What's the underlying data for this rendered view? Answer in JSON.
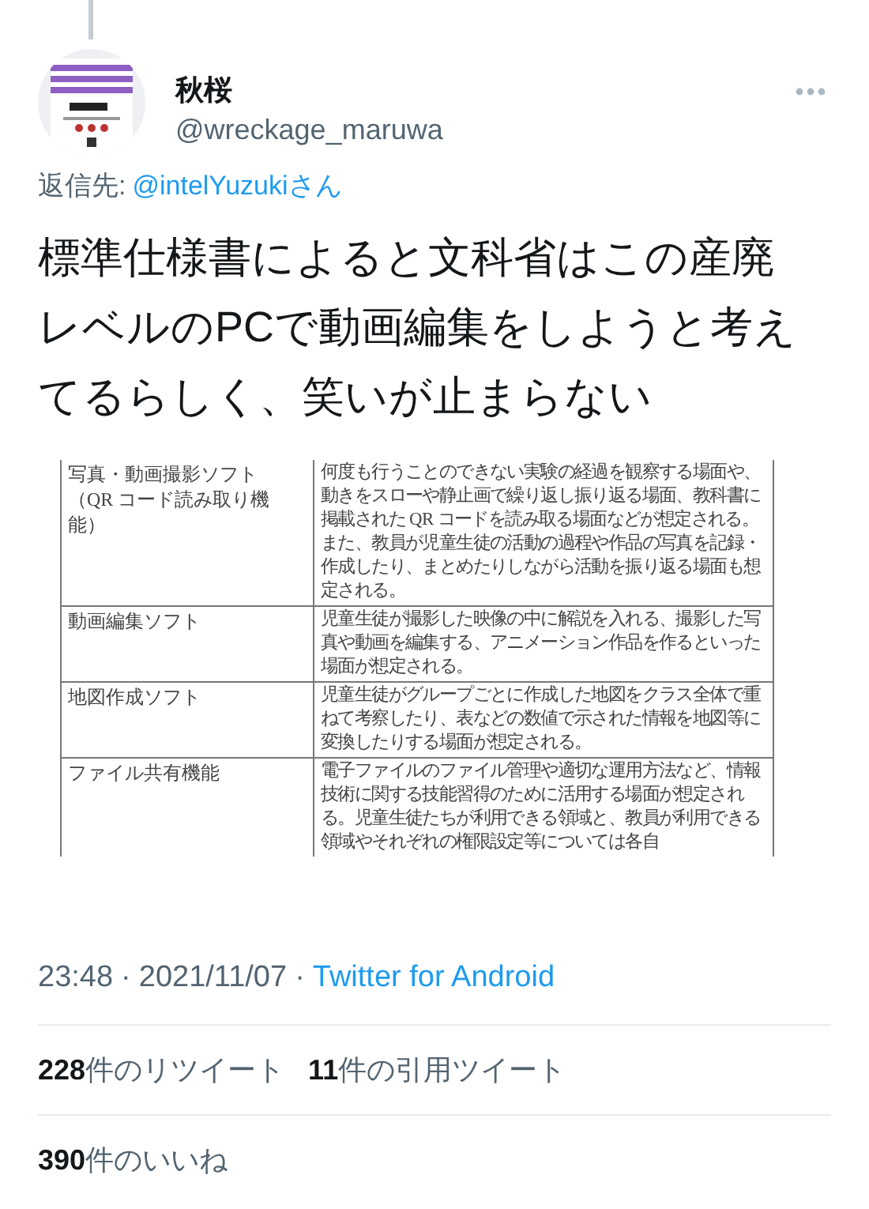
{
  "author": {
    "name": "秋桜",
    "handle": "@wreckage_maruwa"
  },
  "reply_to": {
    "label": "返信先:",
    "user": "@intelYuzukiさん"
  },
  "text": "標準仕様書によると文科省はこの産廃レベルのPCで動画編集をしようと考えてるらしく、笑いが止まらない",
  "document": {
    "rows": [
      {
        "name": [
          "写真・動画撮影ソフト",
          "（QR コード読み取り機能）"
        ],
        "description": "何度も行うことのできない実験の経過を観察する場面や、動きをスローや静止画で繰り返し振り返る場面、教科書に掲載された QR コードを読み取る場面などが想定される。また、教員が児童生徒の活動の過程や作品の写真を記録・作成したり、まとめたりしながら活動を振り返る場面も想定される。"
      },
      {
        "name": [
          "動画編集ソフト"
        ],
        "description": "児童生徒が撮影した映像の中に解説を入れる、撮影した写真や動画を編集する、アニメーション作品を作るといった場面が想定される。"
      },
      {
        "name": [
          "地図作成ソフト"
        ],
        "description": "児童生徒がグループごとに作成した地図をクラス全体で重ねて考察したり、表などの数値で示された情報を地図等に変換したりする場面が想定される。"
      },
      {
        "name": [
          "ファイル共有機能"
        ],
        "description": "電子ファイルのファイル管理や適切な運用方法など、情報技術に関する技能習得のために活用する場面が想定される。児童生徒たちが利用できる領域と、教員が利用できる領域やそれぞれの権限設定等については各自"
      }
    ]
  },
  "timestamp": {
    "time": "23:48",
    "separator": "·",
    "date": "2021/11/07",
    "source": "Twitter for Android"
  },
  "stats": [
    {
      "count": "228",
      "label": "件のリツイート"
    },
    {
      "count": "11",
      "label": "件の引用ツイート"
    }
  ],
  "likes": {
    "count": "390",
    "label": "件のいいね"
  }
}
